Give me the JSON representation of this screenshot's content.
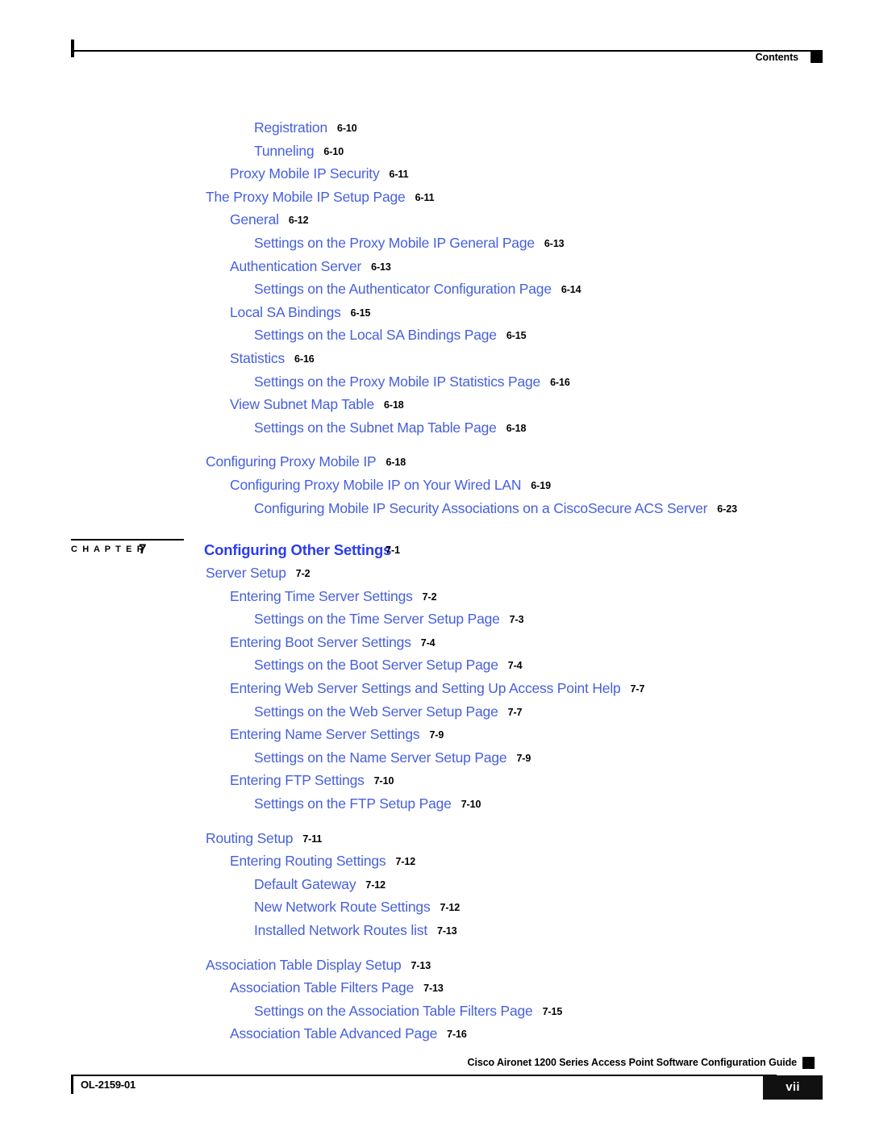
{
  "header": {
    "title": "Contents"
  },
  "chapter": {
    "word": "C H A P T E R",
    "number": "7",
    "title": "Configuring Other Settings",
    "page": "7-1"
  },
  "footer": {
    "doc_title": "Cisco Aironet 1200 Series Access Point Software Configuration Guide",
    "doc_id": "OL-2159-01",
    "page_number": "vii"
  },
  "colors": {
    "link_blue": "#4760DD",
    "chapter_blue": "#2B3CF0",
    "page_black": "#000000"
  },
  "toc_before_chapter": [
    {
      "label": "Registration",
      "page": "6-10",
      "level": 2
    },
    {
      "label": "Tunneling",
      "page": "6-10",
      "level": 2
    },
    {
      "label": "Proxy Mobile IP Security",
      "page": "6-11",
      "level": 1
    },
    {
      "label": "The Proxy Mobile IP Setup Page",
      "page": "6-11",
      "level": 0
    },
    {
      "label": "General",
      "page": "6-12",
      "level": 1
    },
    {
      "label": "Settings on the Proxy Mobile IP General Page",
      "page": "6-13",
      "level": 2
    },
    {
      "label": "Authentication Server",
      "page": "6-13",
      "level": 1
    },
    {
      "label": "Settings on the Authenticator Configuration Page",
      "page": "6-14",
      "level": 2
    },
    {
      "label": "Local SA Bindings",
      "page": "6-15",
      "level": 1
    },
    {
      "label": "Settings on the Local SA Bindings Page",
      "page": "6-15",
      "level": 2
    },
    {
      "label": "Statistics",
      "page": "6-16",
      "level": 1
    },
    {
      "label": "Settings on the Proxy Mobile IP Statistics Page",
      "page": "6-16",
      "level": 2
    },
    {
      "label": "View Subnet Map Table",
      "page": "6-18",
      "level": 1
    },
    {
      "label": "Settings on the Subnet Map Table Page",
      "page": "6-18",
      "level": 2
    },
    {
      "label": "Configuring Proxy Mobile IP",
      "page": "6-18",
      "level": 0,
      "gap_before": true
    },
    {
      "label": "Configuring Proxy Mobile IP on Your Wired LAN",
      "page": "6-19",
      "level": 1
    },
    {
      "label": "Configuring Mobile IP Security Associations on a CiscoSecure ACS Server",
      "page": "6-23",
      "level": 2
    }
  ],
  "toc_after_chapter": [
    {
      "label": "Server Setup",
      "page": "7-2",
      "level": 0
    },
    {
      "label": "Entering Time Server Settings",
      "page": "7-2",
      "level": 1
    },
    {
      "label": "Settings on the Time Server Setup Page",
      "page": "7-3",
      "level": 2
    },
    {
      "label": "Entering Boot Server Settings",
      "page": "7-4",
      "level": 1
    },
    {
      "label": "Settings on the Boot Server Setup Page",
      "page": "7-4",
      "level": 2
    },
    {
      "label": "Entering Web Server Settings and Setting Up Access Point Help",
      "page": "7-7",
      "level": 1
    },
    {
      "label": "Settings on the Web Server Setup Page",
      "page": "7-7",
      "level": 2
    },
    {
      "label": "Entering Name Server Settings",
      "page": "7-9",
      "level": 1
    },
    {
      "label": "Settings on the Name Server Setup Page",
      "page": "7-9",
      "level": 2
    },
    {
      "label": "Entering FTP Settings",
      "page": "7-10",
      "level": 1
    },
    {
      "label": "Settings on the FTP Setup Page",
      "page": "7-10",
      "level": 2
    },
    {
      "label": "Routing Setup",
      "page": "7-11",
      "level": 0,
      "gap_before": true
    },
    {
      "label": "Entering Routing Settings",
      "page": "7-12",
      "level": 1
    },
    {
      "label": "Default Gateway",
      "page": "7-12",
      "level": 2
    },
    {
      "label": "New Network Route Settings",
      "page": "7-12",
      "level": 2
    },
    {
      "label": "Installed Network Routes list",
      "page": "7-13",
      "level": 2
    },
    {
      "label": "Association Table Display Setup",
      "page": "7-13",
      "level": 0,
      "gap_before": true
    },
    {
      "label": "Association Table Filters Page",
      "page": "7-13",
      "level": 1
    },
    {
      "label": "Settings on the Association Table Filters Page",
      "page": "7-15",
      "level": 2
    },
    {
      "label": "Association Table Advanced Page",
      "page": "7-16",
      "level": 1
    }
  ]
}
